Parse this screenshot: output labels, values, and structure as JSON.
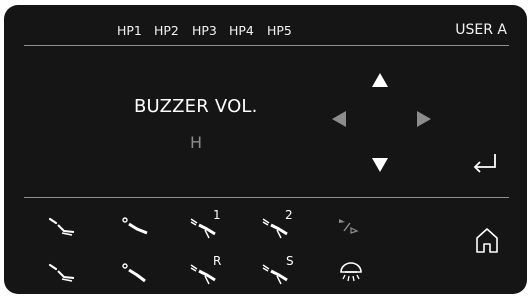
{
  "header": {
    "hp_tabs": [
      "HP1",
      "HP2",
      "HP3",
      "HP4",
      "HP5"
    ],
    "user": "USER A"
  },
  "setting": {
    "title": "BUZZER VOL.",
    "value": "H"
  },
  "nav": {
    "up": "triangle-up-icon",
    "down": "triangle-down-icon",
    "left": "triangle-left-icon",
    "right": "triangle-right-icon",
    "enter": "enter-return-icon"
  },
  "instruments": {
    "row1_tags": [
      "1",
      "2"
    ],
    "row2_tags": [
      "R",
      "S"
    ]
  },
  "colors": {
    "panel_bg": "#151515",
    "active": "#ffffff",
    "disabled": "#8c8c8c"
  }
}
